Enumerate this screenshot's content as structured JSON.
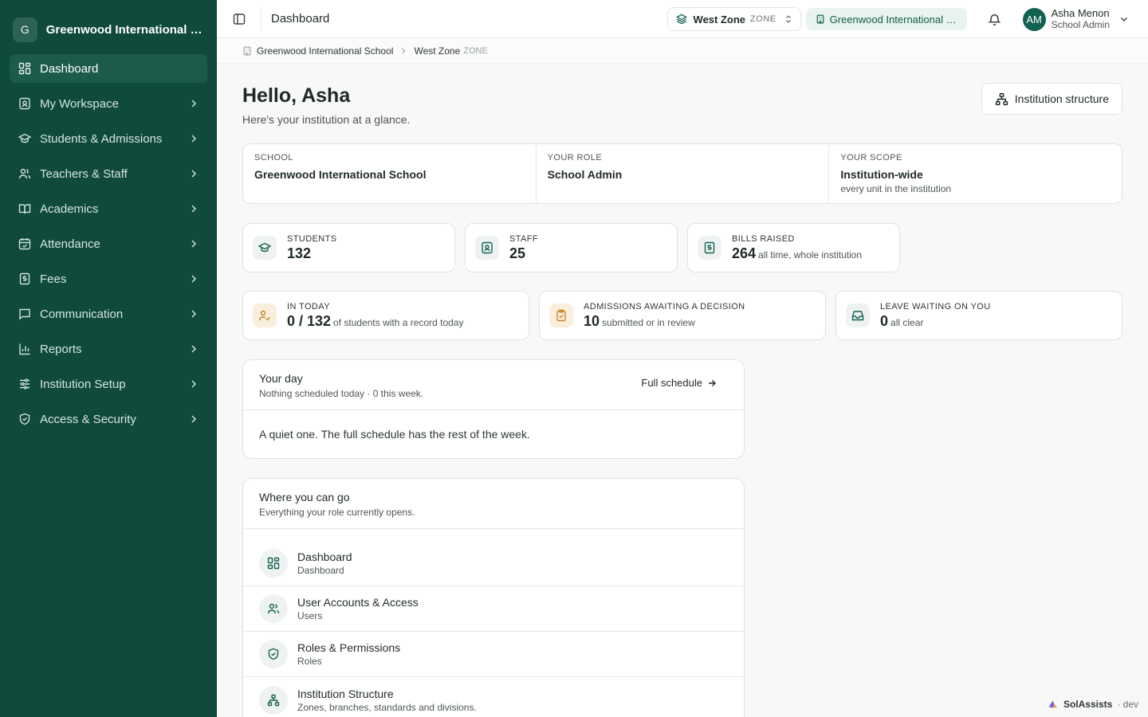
{
  "sidebar": {
    "badge": "G",
    "school_name": "Greenwood International School",
    "items": [
      {
        "label": "Dashboard"
      },
      {
        "label": "My Workspace"
      },
      {
        "label": "Students & Admissions"
      },
      {
        "label": "Teachers & Staff"
      },
      {
        "label": "Academics"
      },
      {
        "label": "Attendance"
      },
      {
        "label": "Fees"
      },
      {
        "label": "Communication"
      },
      {
        "label": "Reports"
      },
      {
        "label": "Institution Setup"
      },
      {
        "label": "Access & Security"
      }
    ]
  },
  "topbar": {
    "title": "Dashboard",
    "zone_name": "West Zone",
    "zone_kind": "ZONE",
    "school": "Greenwood International School",
    "user_initials": "AM",
    "user_name": "Asha Menon",
    "user_role": "School Admin"
  },
  "breadcrumb": {
    "school": "Greenwood International School",
    "zone": "West Zone",
    "zone_kind": "ZONE"
  },
  "main": {
    "greeting": "Hello, Asha",
    "subtitle": "Here's your institution at a glance.",
    "structure_button": "Institution structure",
    "context": [
      {
        "key": "SCHOOL",
        "value": "Greenwood International School",
        "sub": ""
      },
      {
        "key": "YOUR ROLE",
        "value": "School Admin",
        "sub": ""
      },
      {
        "key": "YOUR SCOPE",
        "value": "Institution-wide",
        "sub": "every unit in the institution"
      }
    ],
    "stats": [
      {
        "key": "STUDENTS",
        "value": "132",
        "note": ""
      },
      {
        "key": "STAFF",
        "value": "25",
        "note": ""
      },
      {
        "key": "BILLS RAISED",
        "value": "264",
        "note": "all time, whole institution"
      }
    ],
    "today": [
      {
        "key": "IN TODAY",
        "value": "0 / 132",
        "note": "of students with a record today"
      },
      {
        "key": "ADMISSIONS AWAITING A DECISION",
        "value": "10",
        "note": "submitted or in review"
      },
      {
        "key": "LEAVE WAITING ON YOU",
        "value": "0",
        "note": "all clear"
      }
    ],
    "your_day": {
      "title": "Your day",
      "sub": "Nothing scheduled today · 0 this week.",
      "link": "Full schedule",
      "body": "A quiet one. The full schedule has the rest of the week."
    },
    "where": {
      "title": "Where you can go",
      "sub": "Everything your role currently opens.",
      "items": [
        {
          "title": "Dashboard",
          "sub": "Dashboard"
        },
        {
          "title": "User Accounts & Access",
          "sub": "Users"
        },
        {
          "title": "Roles & Permissions",
          "sub": "Roles"
        },
        {
          "title": "Institution Structure",
          "sub": "Zones, branches, standards and divisions."
        }
      ]
    }
  },
  "footer": {
    "brand": "SolAssists",
    "env": "· dev"
  },
  "colors": {
    "sidebar": "#0f4a3d",
    "accent": "#136152",
    "amber": "#c98a2b"
  }
}
